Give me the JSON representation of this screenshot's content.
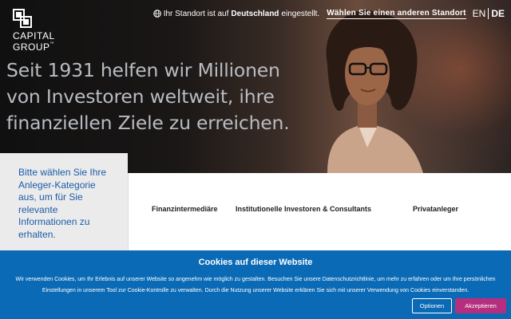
{
  "brand": {
    "line1": "CAPITAL",
    "line2": "GROUP",
    "tm": "™"
  },
  "topbar": {
    "location_prefix": "Ihr Standort ist auf",
    "country": "Deutschland",
    "location_suffix": "eingestellt.",
    "change_link": "Wählen Sie einen anderen Standort",
    "languages": [
      "EN",
      "DE"
    ],
    "active_language": "DE"
  },
  "hero": {
    "headline_lines": [
      "Seit 1931 helfen wir Millionen",
      "von Investoren weltweit, ihre",
      "finanziellen Ziele zu erreichen."
    ]
  },
  "investor": {
    "prompt": "Bitte wählen Sie Ihre Anleger-Kategorie aus, um für Sie relevante Informationen zu erhalten.",
    "categories": [
      "Finanzintermediäre",
      "Institutionelle Investoren & Consultants",
      "Privatanleger"
    ]
  },
  "cookie": {
    "title": "Cookies auf dieser Website",
    "text": "Wir verwenden Cookies, um Ihr Erlebnis auf unserer Website so angenehm wie möglich zu gestalten. Besuchen Sie unsere Datenschutzrichtlinie, um mehr zu erfahren oder um Ihre persönlichen Einstellungen in unserem Tool zur Cookie-Kontrolle zu verwalten. Durch die Nutzung unserer Website erklären Sie sich mit unserer Verwendung von Cookies einverstanden.",
    "options_label": "Optionen",
    "accept_label": "Akzeptieren"
  },
  "colors": {
    "cookie_bg": "#0a6ab5",
    "accept_bg": "#b62f7e",
    "intro_text": "#1a5ca8",
    "headline": "#b8bcc2"
  },
  "icons": {
    "location": "globe-icon",
    "brand": "capital-group-logo-icon"
  }
}
